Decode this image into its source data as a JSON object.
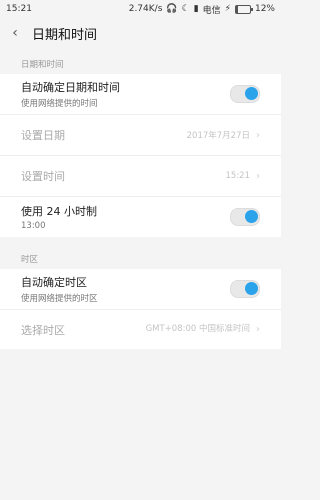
{
  "status_bar": {
    "time": "15:21",
    "net_speed": "2.74K/s",
    "carrier": "电信",
    "battery": "12%",
    "battery_level": 0.12
  },
  "header": {
    "title": "日期和时间"
  },
  "sections": {
    "datetime": {
      "label": "日期和时间",
      "auto_datetime": {
        "title": "自动确定日期和时间",
        "subtitle": "使用网络提供的时间",
        "enabled": true
      },
      "set_date": {
        "title": "设置日期",
        "value": "2017年7月27日"
      },
      "set_time": {
        "title": "设置时间",
        "value": "15:21"
      },
      "use_24h": {
        "title": "使用 24 小时制",
        "subtitle": "13:00",
        "enabled": true
      }
    },
    "timezone": {
      "label": "时区",
      "auto_timezone": {
        "title": "自动确定时区",
        "subtitle": "使用网络提供的时区",
        "enabled": true
      },
      "select_timezone": {
        "title": "选择时区",
        "value": "GMT+08:00 中国标准时间"
      }
    }
  },
  "colors": {
    "accent": "#2aa3ea",
    "background": "#f4f4f4"
  }
}
